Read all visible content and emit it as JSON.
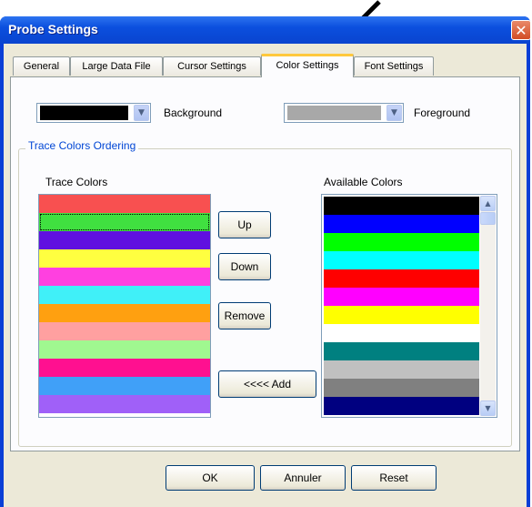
{
  "window": {
    "title": "Probe Settings",
    "close_glyph": "✕"
  },
  "tabs": [
    {
      "label": "General",
      "active": false
    },
    {
      "label": "Large Data File",
      "active": false
    },
    {
      "label": "Cursor Settings",
      "active": false
    },
    {
      "label": "Color Settings",
      "active": true
    },
    {
      "label": "Font Settings",
      "active": false
    }
  ],
  "background_select": {
    "label": "Background",
    "value_color": "#000000"
  },
  "foreground_select": {
    "label": "Foreground",
    "value_color": "#a8a8a8"
  },
  "group": {
    "title": "Trace Colors  Ordering"
  },
  "trace_colors": {
    "label": "Trace Colors",
    "items": [
      "#f85050",
      "#40e040",
      "#6010e0",
      "#ffff40",
      "#ff40e0",
      "#40f0f8",
      "#ffa010",
      "#ffa0a0",
      "#a0f890",
      "#ff1090",
      "#40a0f8",
      "#a060f8"
    ],
    "selected_index": 1
  },
  "available_colors": {
    "label": "Available Colors",
    "items": [
      "#000000",
      "#0000ff",
      "#00ff00",
      "#00ffff",
      "#ff0000",
      "#ff00ff",
      "#ffff00",
      "#ffffff",
      "#008080",
      "#c0c0c0",
      "#808080",
      "#000080"
    ]
  },
  "buttons": {
    "up": "Up",
    "down": "Down",
    "remove": "Remove",
    "add": "<<<< Add",
    "ok": "OK",
    "cancel": "Annuler",
    "reset": "Reset"
  },
  "icons": {
    "dropdown": "chevron-down-icon",
    "scroll_up": "chevron-up-icon",
    "scroll_down": "chevron-down-icon"
  }
}
